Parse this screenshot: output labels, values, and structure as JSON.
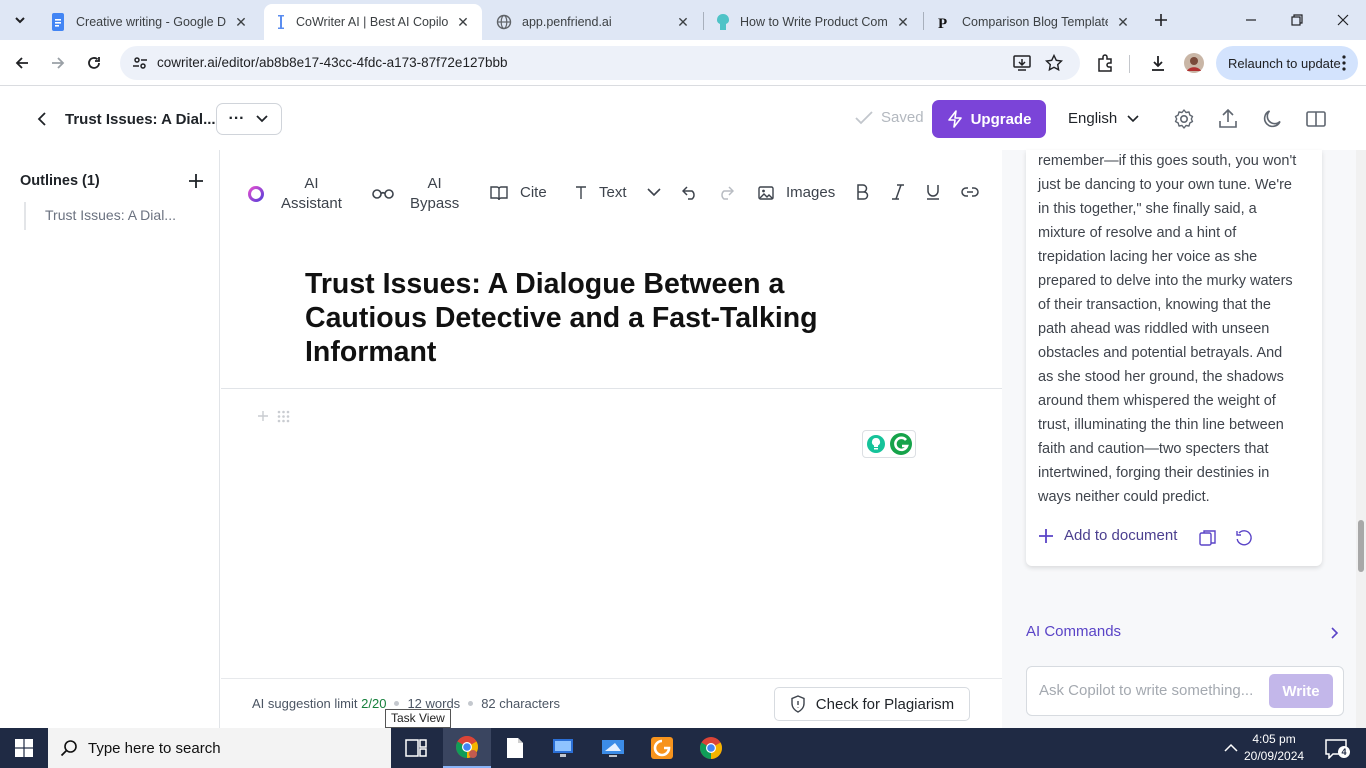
{
  "browser": {
    "tabs": [
      {
        "title": "Creative writing - Google Do",
        "icon": "google-docs-icon",
        "active": false
      },
      {
        "title": "CoWriter AI | Best AI Copilot",
        "icon": "cowriter-icon",
        "active": true
      },
      {
        "title": "app.penfriend.ai",
        "icon": "globe-icon",
        "active": false
      },
      {
        "title": "How to Write Product Comp",
        "icon": "brain-icon",
        "active": false
      },
      {
        "title": "Comparison Blog Template:",
        "icon": "p-logo-icon",
        "active": false
      }
    ],
    "url": "cowriter.ai/editor/ab8b8e17-43cc-4fdc-a173-87f72e127bbb",
    "relaunch_label": "Relaunch to update"
  },
  "app_header": {
    "doc_title": "Trust Issues: A Dial...",
    "more": "···",
    "saved_label": "Saved",
    "upgrade_label": "Upgrade",
    "language": "English"
  },
  "sidebar": {
    "outlines_heading": "Outlines (1)",
    "items": [
      {
        "label": "Trust Issues: A Dial..."
      }
    ]
  },
  "editor_toolbar": {
    "ai_assistant": [
      "AI",
      "Assistant"
    ],
    "ai_bypass": [
      "AI",
      "Bypass"
    ],
    "cite": "Cite",
    "text": "Text",
    "images": "Images"
  },
  "document": {
    "title": "Trust Issues: A Dialogue Between a Cautious Detective and a Fast-Talking Informant"
  },
  "status": {
    "suggestion_label": "AI suggestion limit",
    "suggestion_count": "2/20",
    "words": "12 words",
    "characters": "82 characters",
    "plagiarism_button": "Check for Plagiarism",
    "tooltip": "Task View"
  },
  "right_panel": {
    "ai_output_lines": [
      "remember—if this goes south, you won't",
      "just be dancing to your own tune. We're",
      "in this together,\" she finally said, a",
      "mixture of resolve and a hint of",
      "trepidation lacing her voice as she",
      "prepared to delve into the murky waters",
      "of their transaction, knowing that the",
      "path ahead was riddled with unseen",
      "obstacles and potential betrayals. And",
      "as she stood her ground, the shadows",
      "around them whispered the weight of",
      "trust, illuminating the thin line between",
      "faith and caution—two specters that",
      "intertwined, forging their destinies in",
      "ways neither could predict."
    ],
    "add_to_document": "Add to document",
    "ai_commands": "AI Commands",
    "ask_placeholder": "Ask Copilot to write something...",
    "write_label": "Write"
  },
  "taskbar": {
    "search_placeholder": "Type here to search",
    "time": "4:05 pm",
    "date": "20/09/2024",
    "notification_count": "4"
  },
  "colors": {
    "accent": "#7b44d8",
    "tabstrip": "#dfe7f5",
    "taskbar": "#1f2a44"
  }
}
